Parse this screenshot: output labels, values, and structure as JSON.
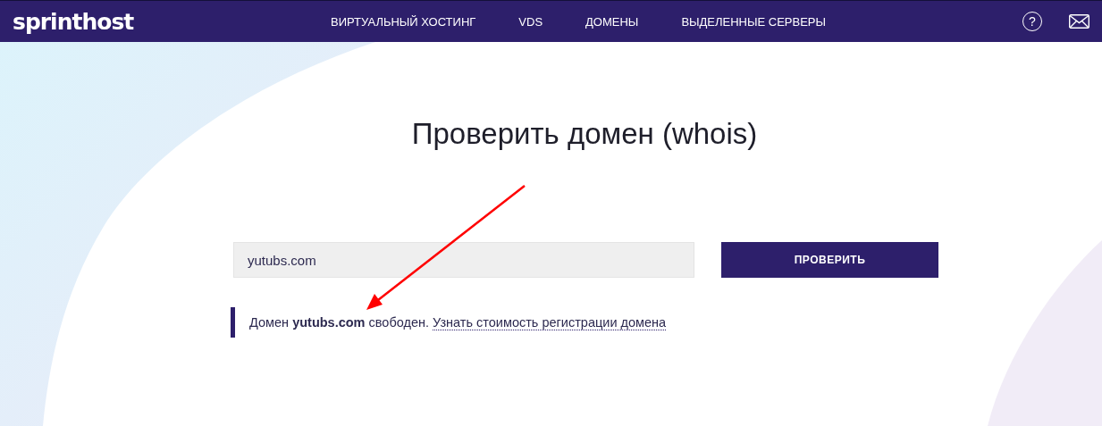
{
  "header": {
    "logo": "sprinthost",
    "nav": [
      {
        "label": "ВИРТУАЛЬНЫЙ ХОСТИНГ"
      },
      {
        "label": "VDS"
      },
      {
        "label": "ДОМЕНЫ"
      },
      {
        "label": "ВЫДЕЛЕННЫЕ СЕРВЕРЫ"
      }
    ],
    "help": "?"
  },
  "title": "Проверить домен (whois)",
  "search": {
    "value": "yutubs.com",
    "button": "ПРОВЕРИТЬ"
  },
  "result": {
    "text": "Домен **yutubs.com** свободен. ",
    "link": "Узнать стоимость регистрации домена"
  }
}
